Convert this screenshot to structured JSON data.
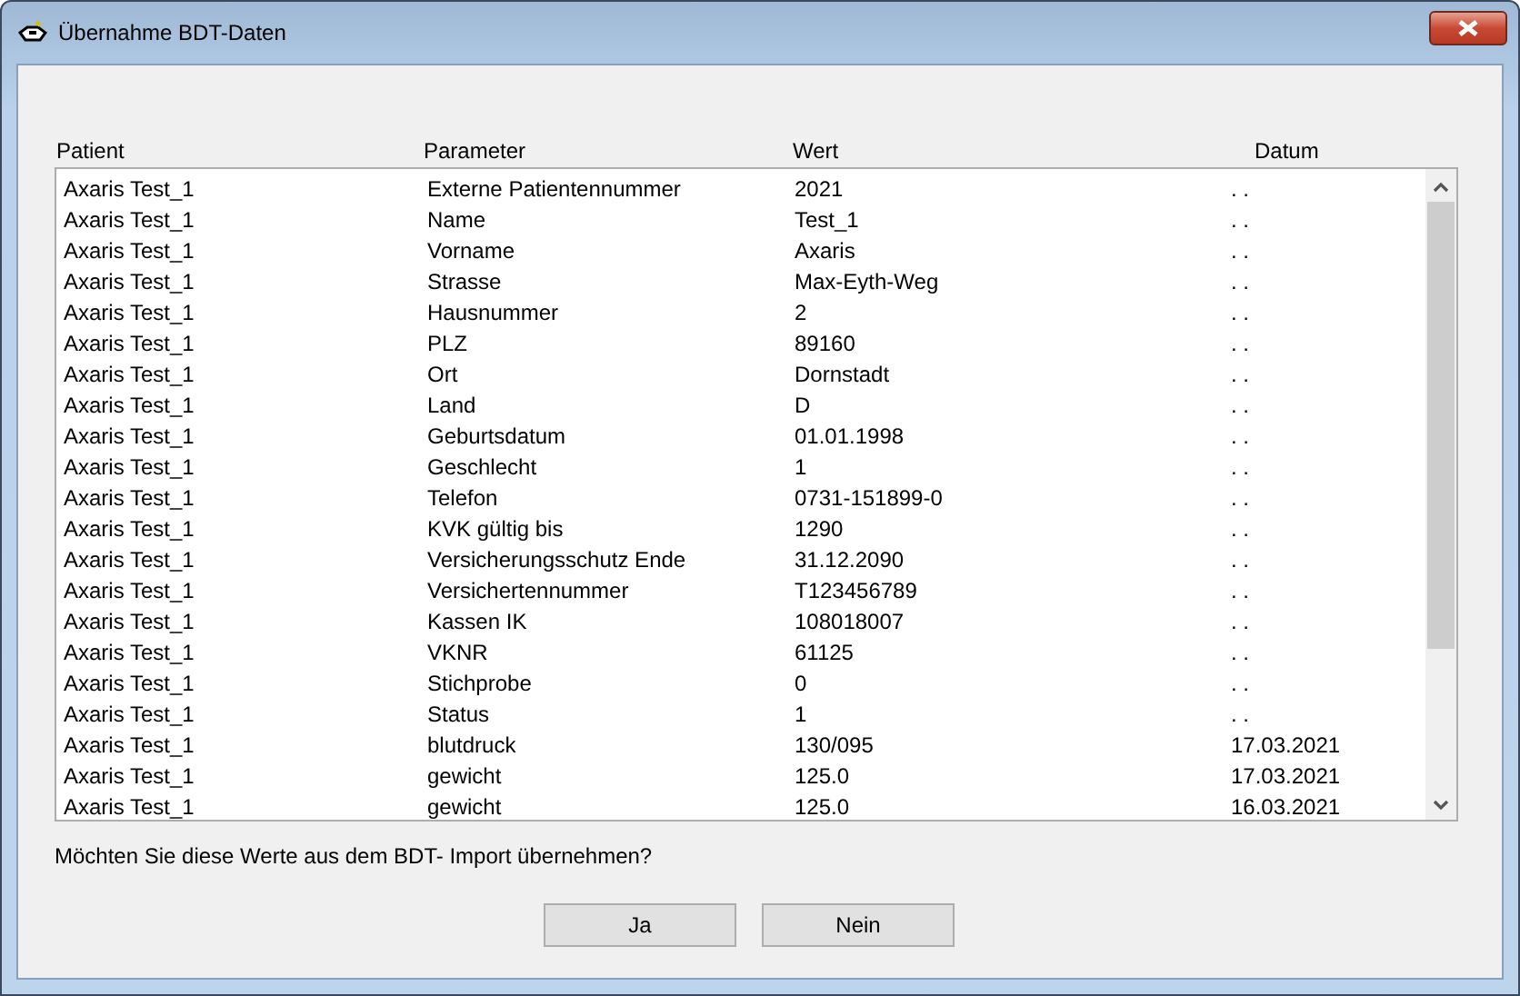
{
  "window": {
    "title": "Übernahme BDT-Daten"
  },
  "table": {
    "columns": [
      "Patient",
      "Parameter",
      "Wert",
      "Datum"
    ],
    "rows": [
      [
        "Axaris Test_1",
        "Externe Patientennummer",
        "2021",
        ". ."
      ],
      [
        "Axaris Test_1",
        "Name",
        "Test_1",
        ". ."
      ],
      [
        "Axaris Test_1",
        "Vorname",
        "Axaris",
        ". ."
      ],
      [
        "Axaris Test_1",
        "Strasse",
        "Max-Eyth-Weg",
        ". ."
      ],
      [
        "Axaris Test_1",
        "Hausnummer",
        "2",
        ". ."
      ],
      [
        "Axaris Test_1",
        "PLZ",
        "89160",
        ". ."
      ],
      [
        "Axaris Test_1",
        "Ort",
        "Dornstadt",
        ". ."
      ],
      [
        "Axaris Test_1",
        "Land",
        "D",
        ". ."
      ],
      [
        "Axaris Test_1",
        "Geburtsdatum",
        "01.01.1998",
        ". ."
      ],
      [
        "Axaris Test_1",
        "Geschlecht",
        "1",
        ". ."
      ],
      [
        "Axaris Test_1",
        "Telefon",
        "0731-151899-0",
        ". ."
      ],
      [
        "Axaris Test_1",
        "KVK gültig bis",
        "1290",
        ". ."
      ],
      [
        "Axaris Test_1",
        "Versicherungsschutz Ende",
        "31.12.2090",
        ". ."
      ],
      [
        "Axaris Test_1",
        "Versichertennummer",
        "T123456789",
        ". ."
      ],
      [
        "Axaris Test_1",
        "Kassen IK",
        "108018007",
        ". ."
      ],
      [
        "Axaris Test_1",
        "VKNR",
        "61125",
        ". ."
      ],
      [
        "Axaris Test_1",
        "Stichprobe",
        "0",
        ". ."
      ],
      [
        "Axaris Test_1",
        "Status",
        "1",
        ". ."
      ],
      [
        "Axaris Test_1",
        "blutdruck",
        "130/095",
        "17.03.2021"
      ],
      [
        "Axaris Test_1",
        "gewicht",
        "125.0",
        "17.03.2021"
      ],
      [
        "Axaris Test_1",
        "gewicht",
        "125.0",
        "16.03.2021"
      ]
    ]
  },
  "question": "Möchten Sie diese Werte aus dem BDT- Import übernehmen?",
  "buttons": [
    "Ja",
    "Nein"
  ]
}
